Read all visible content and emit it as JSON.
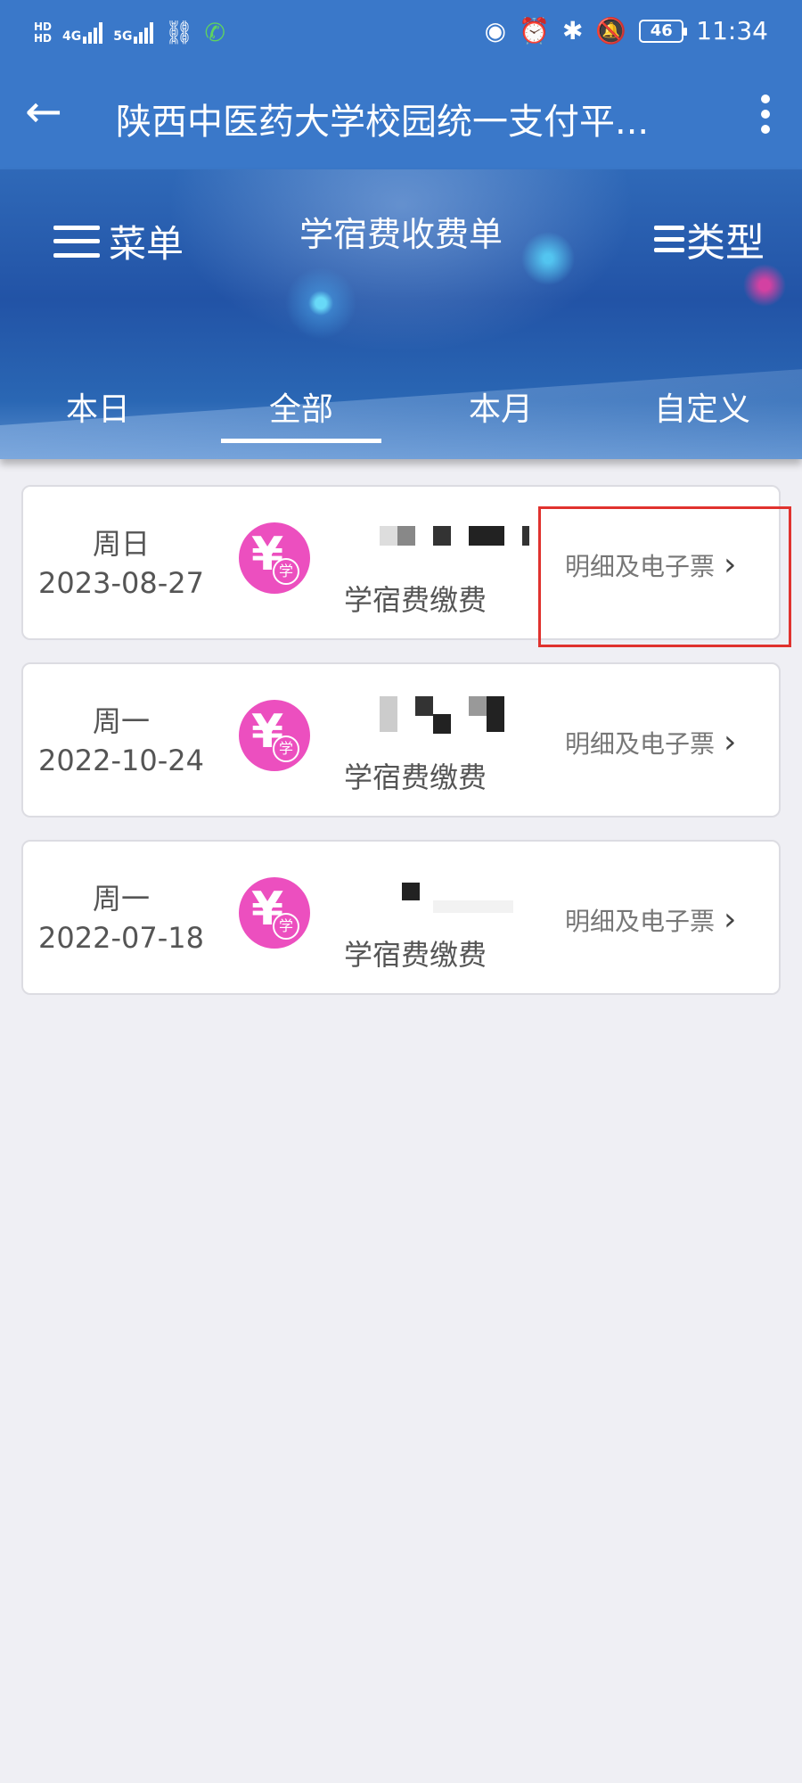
{
  "status_bar": {
    "hd1": "HD",
    "hd2": "HD",
    "net1": "4G",
    "net2": "5G",
    "battery": "46",
    "time": "11:34"
  },
  "appbar": {
    "title": "陕西中医药大学校园统一支付平..."
  },
  "banner": {
    "menu_label": "菜单",
    "title": "学宿费收费单",
    "type_label": "类型"
  },
  "tabs": [
    {
      "label": "本日"
    },
    {
      "label": "全部"
    },
    {
      "label": "本月"
    },
    {
      "label": "自定义"
    }
  ],
  "active_tab": "全部",
  "records": [
    {
      "weekday": "周日",
      "date": "2023-08-27",
      "fee_name": "学宿费缴费",
      "detail_label": "明细及电子票"
    },
    {
      "weekday": "周一",
      "date": "2022-10-24",
      "fee_name": "学宿费缴费",
      "detail_label": "明细及电子票"
    },
    {
      "weekday": "周一",
      "date": "2022-07-18",
      "fee_name": "学宿费缴费",
      "detail_label": "明细及电子票"
    }
  ],
  "icon": {
    "yen": "¥",
    "badge": "学"
  },
  "colors": {
    "header": "#3a78c9",
    "fee_icon": "#ec4fbf",
    "highlight": "#e0322e",
    "background": "#efeff4"
  }
}
